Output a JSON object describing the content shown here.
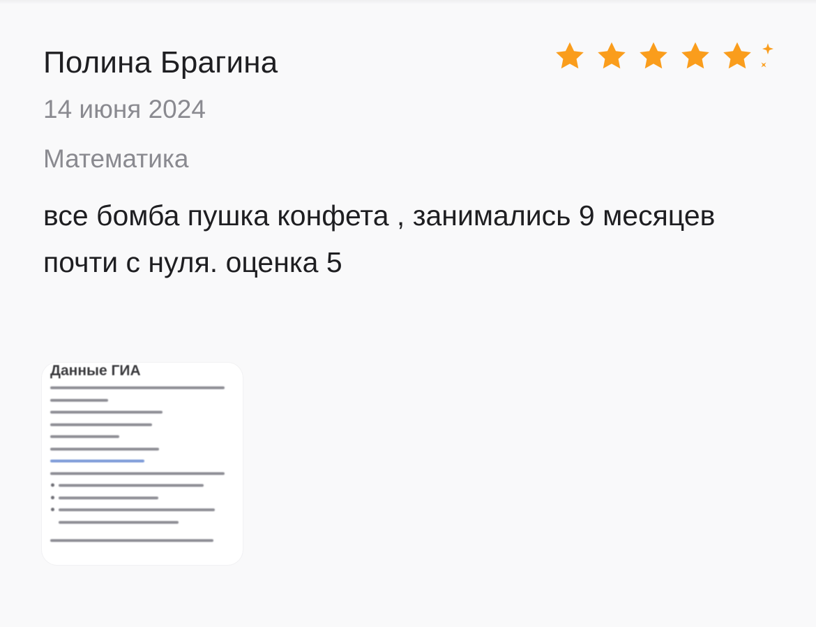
{
  "review": {
    "author": "Полина Брагина",
    "date": "14 июня 2024",
    "subject": "Математика",
    "text": "все бомба пушка конфета , занимались 9 месяцев почти с нуля. оценка 5",
    "rating": 5,
    "rating_max": 5,
    "star_color": "#fa9d1c"
  },
  "attachment": {
    "title": "Данные ГИА"
  },
  "icons": {
    "star": "star-icon",
    "sparkle": "sparkle-icon"
  }
}
